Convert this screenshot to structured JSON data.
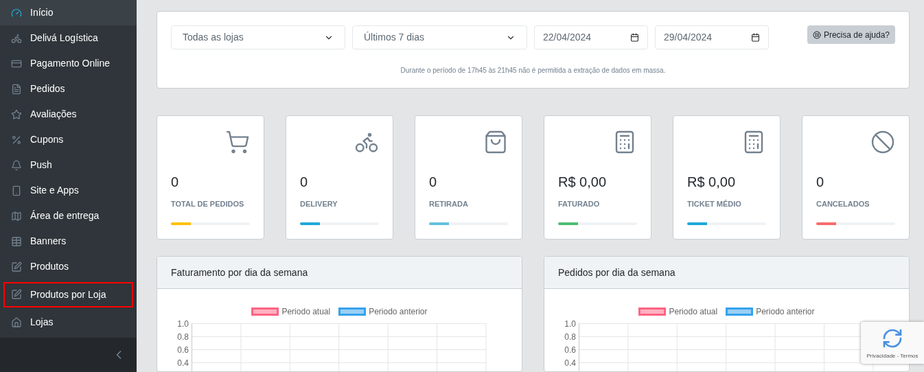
{
  "sidebar": {
    "items": [
      {
        "label": "Início",
        "selected": true,
        "highlighted": false
      },
      {
        "label": "Delivá Logística",
        "selected": false,
        "highlighted": false
      },
      {
        "label": "Pagamento Online",
        "selected": false,
        "highlighted": false
      },
      {
        "label": "Pedidos",
        "selected": false,
        "highlighted": false
      },
      {
        "label": "Avaliações",
        "selected": false,
        "highlighted": false
      },
      {
        "label": "Cupons",
        "selected": false,
        "highlighted": false
      },
      {
        "label": "Push",
        "selected": false,
        "highlighted": false
      },
      {
        "label": "Site e Apps",
        "selected": false,
        "highlighted": false
      },
      {
        "label": "Área de entrega",
        "selected": false,
        "highlighted": false
      },
      {
        "label": "Banners",
        "selected": false,
        "highlighted": false
      },
      {
        "label": "Produtos",
        "selected": false,
        "highlighted": false
      },
      {
        "label": "Produtos por Loja",
        "selected": false,
        "highlighted": true
      },
      {
        "label": "Lojas",
        "selected": false,
        "highlighted": false
      }
    ]
  },
  "filters": {
    "store_select": "Todas as lojas",
    "period_select": "Últimos 7 dias",
    "date_from": "22/04/2024",
    "date_to": "29/04/2024",
    "help_button": "Precisa de ajuda?",
    "notice": "Durante o período de 17h45 às 21h45 não é permitida a extração de dados em massa."
  },
  "stats": [
    {
      "value": "0",
      "label": "TOTAL DE PEDIDOS",
      "level": 0.25,
      "color": "#ffc107"
    },
    {
      "value": "0",
      "label": "DELIVERY",
      "level": 0.25,
      "color": "#20a8d8"
    },
    {
      "value": "0",
      "label": "RETIRADA",
      "level": 0.25,
      "color": "#63c2de"
    },
    {
      "value": "R$ 0,00",
      "label": "FATURADO",
      "level": 0.25,
      "color": "#4dbd74"
    },
    {
      "value": "R$ 0,00",
      "label": "TICKET MÉDIO",
      "level": 0.25,
      "color": "#20a8d8"
    },
    {
      "value": "0",
      "label": "CANCELADOS",
      "level": 0.25,
      "color": "#f86c6b"
    }
  ],
  "charts": [
    {
      "title": "Faturamento por dia da semana",
      "chart_data": {
        "type": "line",
        "ylim": [
          0.4,
          1
        ],
        "series": [
          {
            "name": "Periodo atual",
            "color": "#ff6384"
          },
          {
            "name": "Periodo anterior",
            "color": "#36a2eb"
          }
        ],
        "yticks": [
          {
            "value": 1,
            "label": "1.0"
          },
          {
            "value": 0.8,
            "label": "0.8"
          },
          {
            "value": 0.6,
            "label": "0.6"
          },
          {
            "value": 0.4,
            "label": "0.4"
          }
        ]
      }
    },
    {
      "title": "Pedidos por dia da semana",
      "chart_data": {
        "type": "line",
        "ylim": [
          0.4,
          1
        ],
        "series": [
          {
            "name": "Periodo atual",
            "color": "#ff6384"
          },
          {
            "name": "Periodo anterior",
            "color": "#36a2eb"
          }
        ],
        "yticks": [
          {
            "value": 1,
            "label": "1.0"
          },
          {
            "value": 0.8,
            "label": "0.8"
          },
          {
            "value": 0.6,
            "label": "0.6"
          },
          {
            "value": 0.4,
            "label": "0.4"
          }
        ]
      }
    }
  ],
  "recaptcha": {
    "links": "Privacidade - Termos"
  }
}
